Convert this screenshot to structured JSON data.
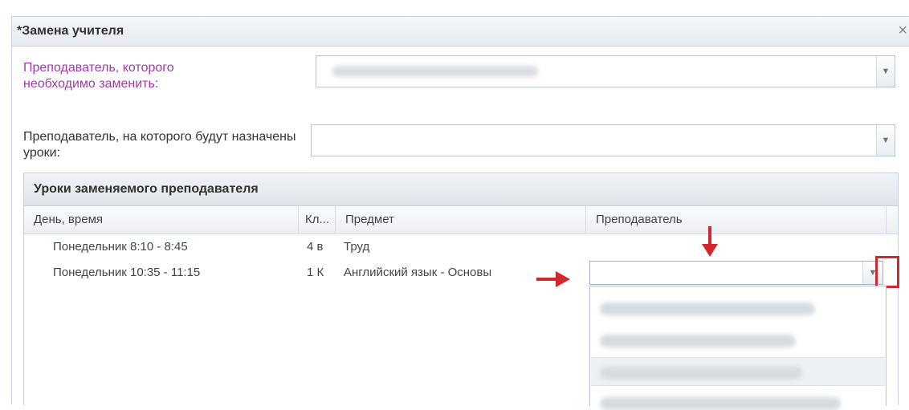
{
  "window": {
    "title": "*Замена учителя",
    "close_icon": "close-icon"
  },
  "form": {
    "teacher_to_replace": {
      "label": "Преподаватель, которого необходимо заменить:",
      "value_blurred": true
    },
    "replacement_teacher": {
      "label": "Преподаватель, на которого будут назначены уроки:",
      "value": ""
    }
  },
  "lessons_panel": {
    "title": "Уроки заменяемого преподавателя",
    "columns": [
      "День, время",
      "Кл...",
      "Предмет",
      "Преподаватель"
    ],
    "rows": [
      {
        "day_time": "Понедельник 8:10 - 8:45",
        "class": "4 в",
        "subject": "Труд",
        "teacher": ""
      },
      {
        "day_time": "Понедельник 10:35 - 11:15",
        "class": "1 К",
        "subject": "Английский язык - Основы",
        "teacher": ""
      }
    ],
    "dropdown_options_count_visible": 4
  },
  "colors": {
    "accent_label": "#a03aa8",
    "annotation_red": "#d0282e",
    "border": "#b9c4cf"
  },
  "icons": {
    "trigger": "chevron-down-icon",
    "annotation": "red-arrow-icon"
  }
}
